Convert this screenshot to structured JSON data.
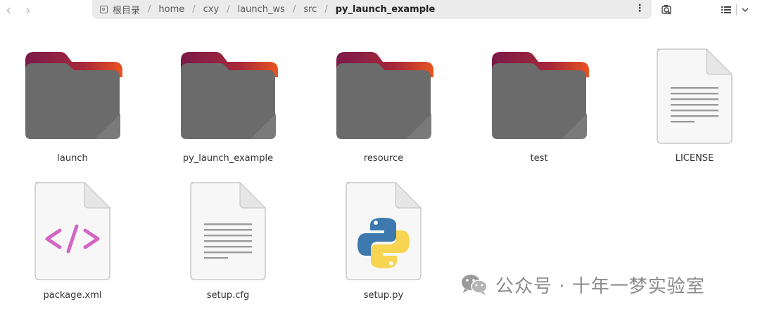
{
  "toolbar": {
    "back_glyph": "‹",
    "forward_glyph": "›",
    "menu_glyph": "⋮",
    "search_icon": "search-icon",
    "view_icon": "list-view-icon",
    "dropdown_icon": "chevron-down-icon"
  },
  "breadcrumb": {
    "root": "根目录",
    "separator": "/",
    "items": [
      "home",
      "cxy",
      "launch_ws",
      "src",
      "py_launch_example"
    ]
  },
  "files": [
    {
      "name": "launch",
      "kind": "folder"
    },
    {
      "name": "py_launch_example",
      "kind": "folder"
    },
    {
      "name": "resource",
      "kind": "folder"
    },
    {
      "name": "test",
      "kind": "folder"
    },
    {
      "name": "LICENSE",
      "kind": "text"
    },
    {
      "name": "package.xml",
      "kind": "xml"
    },
    {
      "name": "setup.cfg",
      "kind": "text"
    },
    {
      "name": "setup.py",
      "kind": "python"
    }
  ],
  "watermark": {
    "text": "公众号 · 十年一梦实验室",
    "icon": "wechat-icon"
  },
  "colors": {
    "folder_body": "#6b6b6b",
    "folder_tab_start": "#7a1a49",
    "folder_tab_end": "#e95420",
    "xml_accent": "#d166c4",
    "python_blue": "#3d78ae",
    "python_yellow": "#f7d451",
    "pathbar_bg": "#ebebeb"
  }
}
